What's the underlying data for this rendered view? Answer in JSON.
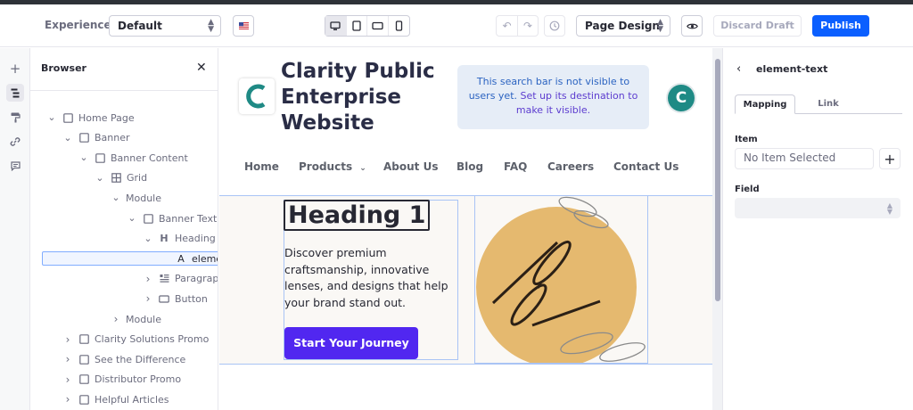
{
  "toolbar": {
    "experience_label": "Experience",
    "experience_value": "Default",
    "language_flag": "us-flag-icon",
    "mode_value": "Page Design",
    "discard_label": "Discard Draft",
    "publish_label": "Publish",
    "devices": [
      "desktop-icon",
      "tablet-icon",
      "landscape-icon",
      "mobile-icon"
    ],
    "active_device": "desktop"
  },
  "rail": {
    "icons": [
      "plus-icon",
      "browser-icon",
      "paint-roller-icon",
      "link-icon",
      "comment-icon"
    ],
    "active": "browser-icon"
  },
  "browser": {
    "title": "Browser",
    "tree": [
      {
        "label": "Home Page",
        "icon": "square-icon",
        "chevron": "expanded"
      },
      {
        "label": "Banner",
        "icon": "square-icon",
        "chevron": "expanded"
      },
      {
        "label": "Banner Content",
        "icon": "square-icon",
        "chevron": "expanded"
      },
      {
        "label": "Grid",
        "icon": "grid-icon",
        "chevron": "expanded"
      },
      {
        "label": "Module",
        "icon": "",
        "chevron": "expanded"
      },
      {
        "label": "Banner Text",
        "icon": "square-icon",
        "chevron": "expanded"
      },
      {
        "label": "Heading",
        "icon": "heading-icon",
        "chevron": "expanded"
      },
      {
        "label": "eleme",
        "icon": "text-icon",
        "chevron": "",
        "selected": true
      },
      {
        "label": "Paragraph",
        "icon": "paragraph-icon",
        "chevron": "collapsed"
      },
      {
        "label": "Button",
        "icon": "button-icon",
        "chevron": "collapsed"
      },
      {
        "label": "Module",
        "icon": "",
        "chevron": "collapsed"
      },
      {
        "label": "Clarity Solutions Promo",
        "icon": "square-icon",
        "chevron": "collapsed"
      },
      {
        "label": "See the Difference",
        "icon": "square-icon",
        "chevron": "collapsed"
      },
      {
        "label": "Distributor Promo",
        "icon": "square-icon",
        "chevron": "collapsed"
      },
      {
        "label": "Helpful Articles",
        "icon": "square-icon",
        "chevron": "collapsed"
      }
    ]
  },
  "site": {
    "title_lines": [
      "Clarity Public",
      "Enterprise",
      "Website"
    ],
    "search_note_plain": "This search bar is not visible to users yet.",
    "search_note_accent": "Set up its destination to make it visible.",
    "avatar_letter": "C",
    "nav": [
      {
        "label": "Home",
        "dropdown": false
      },
      {
        "label": "Products",
        "dropdown": true
      },
      {
        "label": "About Us",
        "dropdown": false
      },
      {
        "label": "Blog",
        "dropdown": false
      },
      {
        "label": "FAQ",
        "dropdown": false
      },
      {
        "label": "Careers",
        "dropdown": false
      },
      {
        "label": "Contact Us",
        "dropdown": false
      }
    ],
    "heading_text": "Heading 1",
    "paragraph": "Discover premium craftsmanship, innovative lenses, and designs that help your brand stand out.",
    "cta_label": "Start Your Journey",
    "accent_color": "#5127f0",
    "brand_teal": "#1f8a85",
    "circle_color": "#e5b96f"
  },
  "properties": {
    "title": "element-text",
    "tabs": [
      {
        "label": "Mapping",
        "active": true
      },
      {
        "label": "Link",
        "active": false
      }
    ],
    "item_label": "Item",
    "item_value": "No Item Selected",
    "field_label": "Field",
    "field_value": ""
  }
}
